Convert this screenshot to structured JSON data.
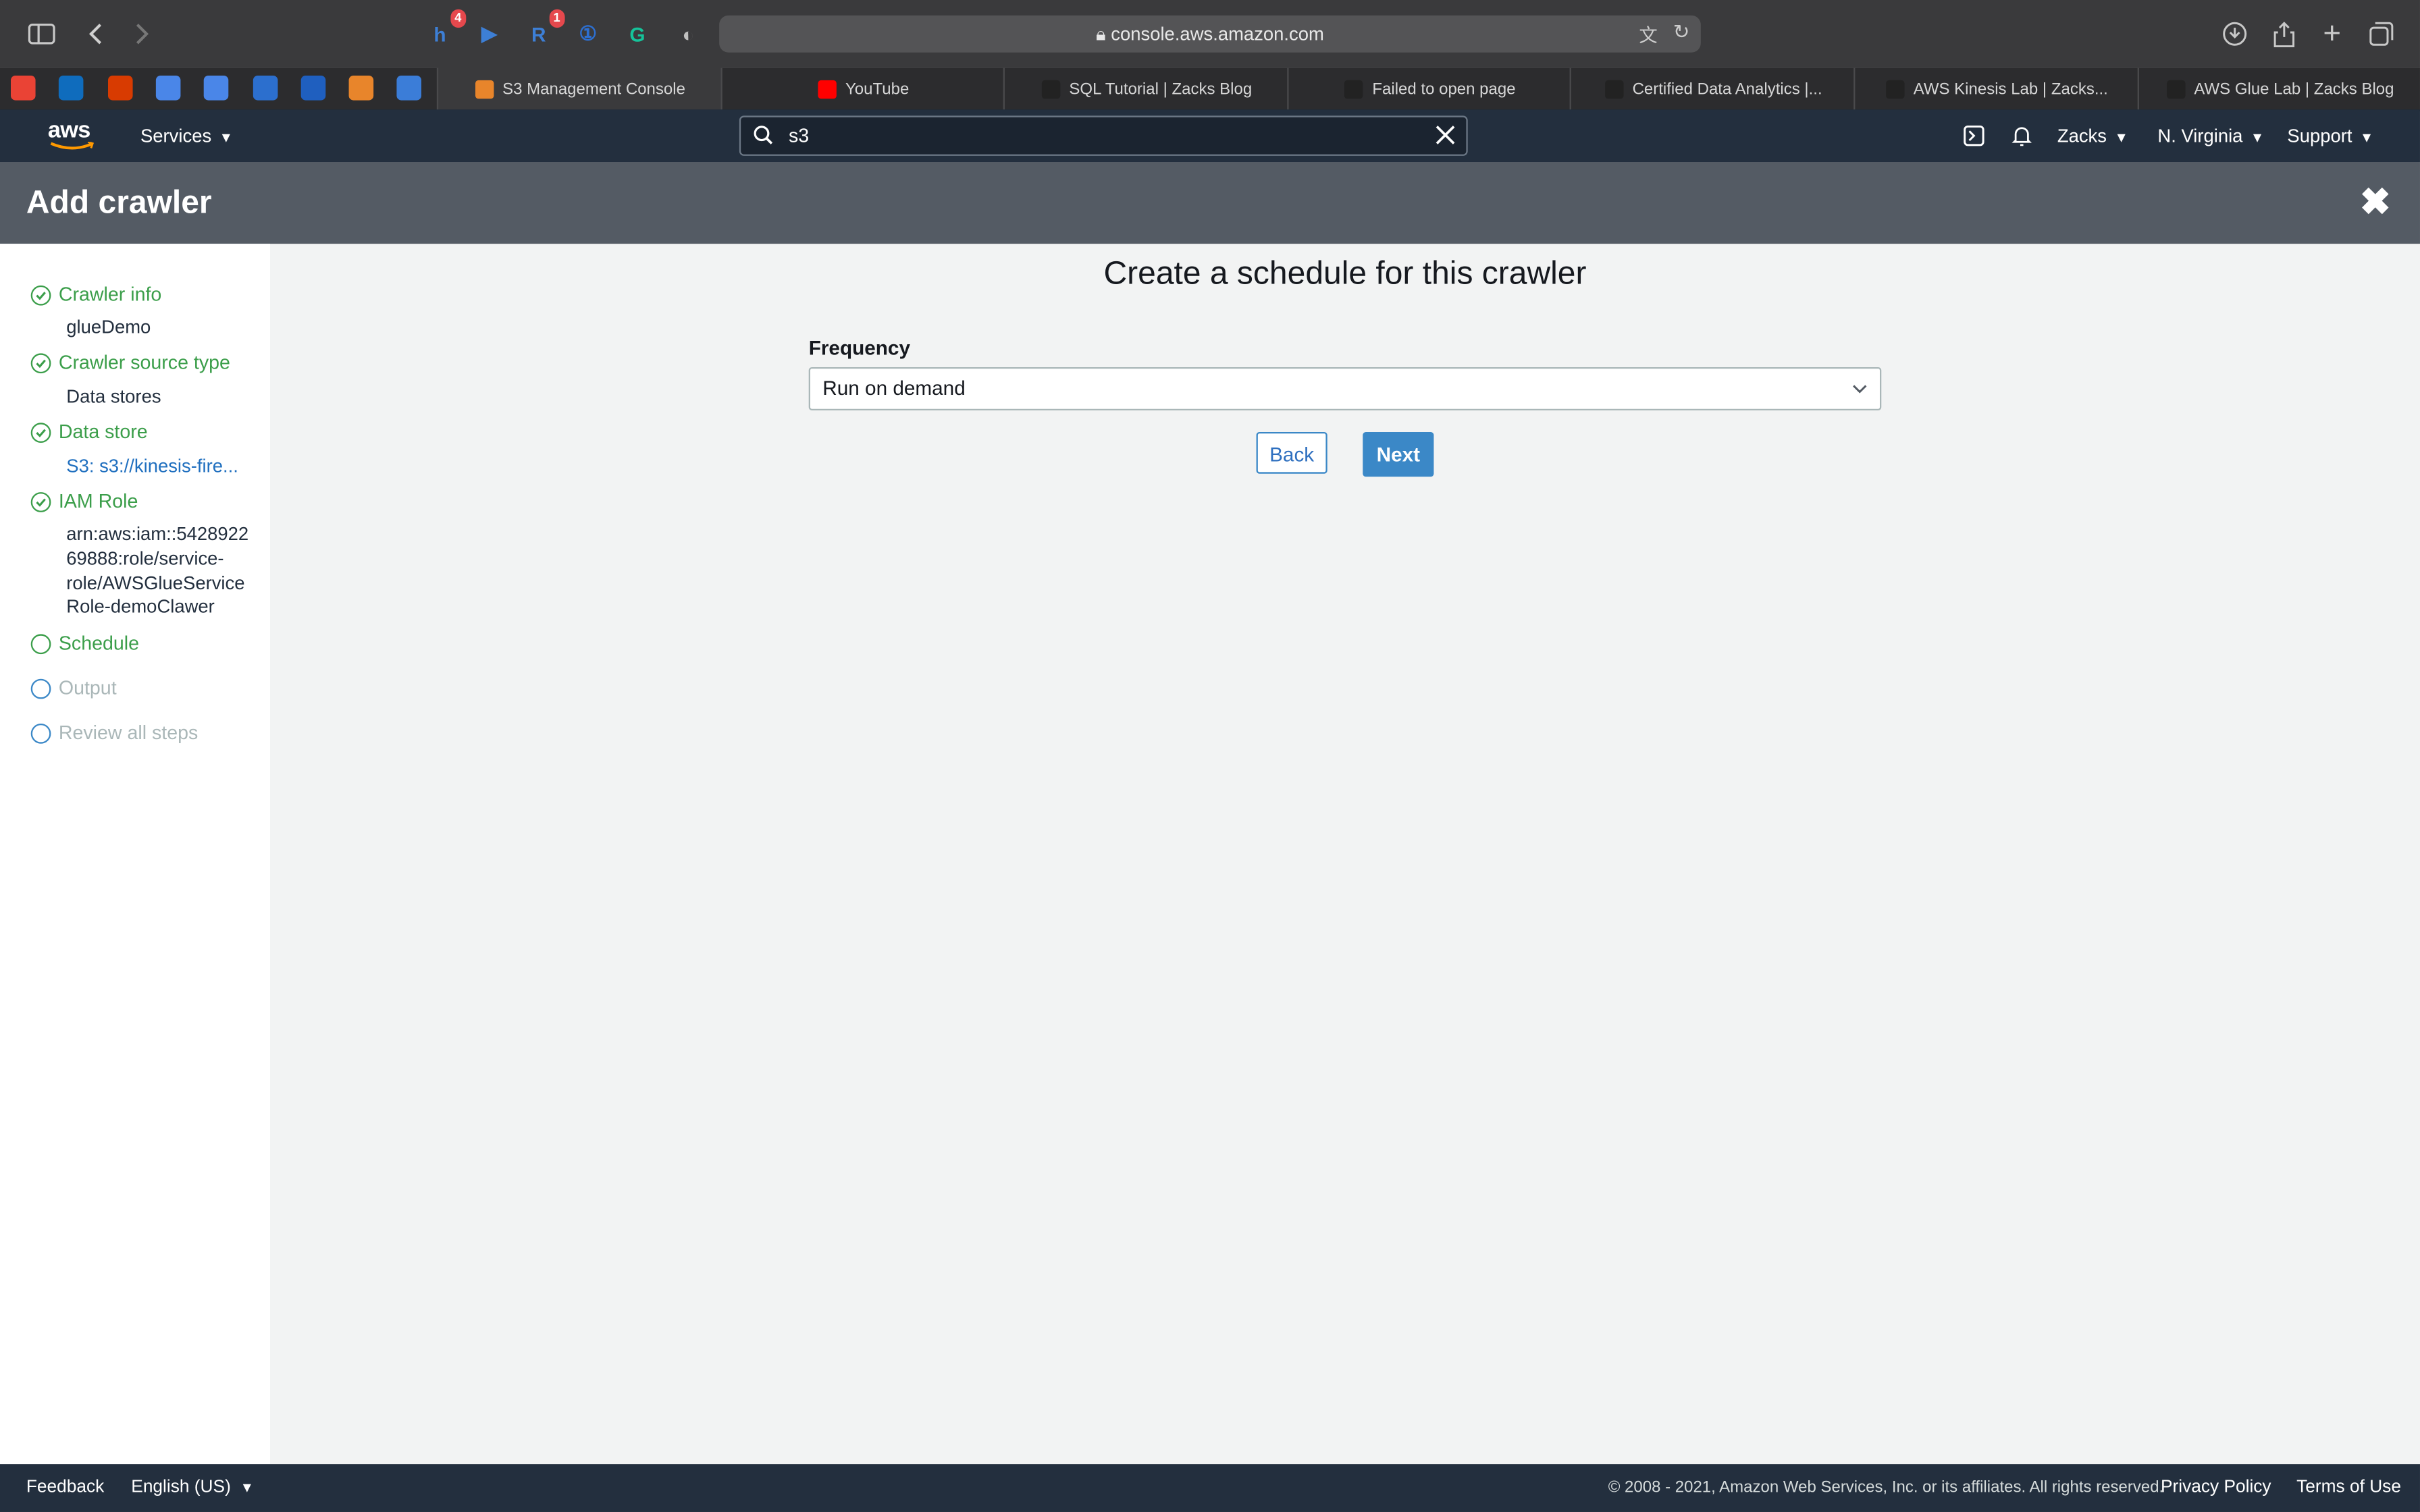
{
  "browser": {
    "url": "console.aws.amazon.com",
    "extensions": [
      {
        "icon": "honey-extension-icon",
        "letter": "h",
        "color": "#3d7fd6",
        "badge": "4"
      },
      {
        "icon": "play-extension-icon",
        "letter": "▶",
        "color": "#3d7fd6",
        "badge": ""
      },
      {
        "icon": "r-extension-icon",
        "letter": "R",
        "color": "#3d7fd6",
        "badge": "1"
      },
      {
        "icon": "password-manager-icon",
        "letter": "①",
        "color": "#2d6fd1",
        "badge": ""
      },
      {
        "icon": "grammarly-icon",
        "letter": "G",
        "color": "#15c39a",
        "badge": ""
      },
      {
        "icon": "privacy-shield-icon",
        "letter": "◐",
        "color": "#c0c0c0",
        "badge": ""
      }
    ],
    "pinned_tabs": [
      {
        "icon": "gmail-icon",
        "color": "#ea4335"
      },
      {
        "icon": "outlook-icon",
        "color": "#0f6cbd"
      },
      {
        "icon": "office-icon",
        "color": "#d83b01"
      },
      {
        "icon": "translate-icon",
        "color": "#4a86e8"
      },
      {
        "icon": "translate-icon",
        "color": "#4a86e8"
      },
      {
        "icon": "calendar-icon",
        "color": "#2c6fce"
      },
      {
        "icon": "app-icon",
        "color": "#1f5fbf"
      },
      {
        "icon": "aws-box-icon",
        "color": "#e8852b"
      },
      {
        "icon": "arrow-app-icon",
        "color": "#3b7dd8"
      }
    ],
    "tabs": [
      {
        "label": "S3 Management Console",
        "fav": "#e8852b"
      },
      {
        "label": "YouTube",
        "fav": "#ff0000"
      },
      {
        "label": "SQL Tutorial | Zacks Blog",
        "fav": "#222"
      },
      {
        "label": "Failed to open page",
        "fav": "#222"
      },
      {
        "label": "Certified Data Analytics |...",
        "fav": "#222"
      },
      {
        "label": "AWS Kinesis Lab | Zacks...",
        "fav": "#222"
      },
      {
        "label": "AWS Glue Lab | Zacks Blog",
        "fav": "#222"
      }
    ]
  },
  "nav": {
    "services": "Services",
    "search_value": "s3",
    "user": "Zacks",
    "region": "N. Virginia",
    "support": "Support"
  },
  "page": {
    "title": "Add crawler"
  },
  "sidebar": {
    "steps": [
      {
        "label": "Crawler info",
        "state": "done",
        "detail": "glueDemo"
      },
      {
        "label": "Crawler source type",
        "state": "done",
        "detail": "Data stores"
      },
      {
        "label": "Data store",
        "state": "done",
        "detail": "S3: s3://kinesis-fire..."
      },
      {
        "label": "IAM Role",
        "state": "done",
        "detail": "arn:aws:iam::542892269888:role/service-role/AWSGlueServiceRole-demoClawer"
      },
      {
        "label": "Schedule",
        "state": "current"
      },
      {
        "label": "Output",
        "state": "todo"
      },
      {
        "label": "Review all steps",
        "state": "todo"
      }
    ],
    "iam_lines": [
      "arn:aws:iam::5428922",
      "69888:role/service-",
      "role/AWSGlueService",
      "Role-demoClawer"
    ]
  },
  "main": {
    "heading": "Create a schedule for this crawler",
    "frequency_label": "Frequency",
    "frequency_value": "Run on demand",
    "back": "Back",
    "next": "Next"
  },
  "footer": {
    "feedback": "Feedback",
    "language": "English (US)",
    "copyright": "© 2008 - 2021, Amazon Web Services, Inc. or its affiliates. All rights reserved.",
    "privacy": "Privacy Policy",
    "terms": "Terms of Use"
  },
  "colors": {
    "aws_nav": "#232f3e",
    "header": "#545b64",
    "success_green": "#3b9e4a",
    "primary_blue": "#3b88c7"
  }
}
